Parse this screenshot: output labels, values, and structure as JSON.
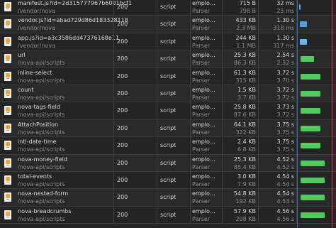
{
  "rows": [
    {
      "name": "manifest.js?id=2d315777967b6001bcf1",
      "path": "/vendor/nova",
      "status": "200",
      "type": "script",
      "init1": "emplo…",
      "init2": "Parser",
      "size1": "715 B",
      "size2": "798 B",
      "time1": "32 ms",
      "time2": "25 ms",
      "bar_start": 0.0,
      "bar_len": 0.03,
      "bar_color": "blue"
    },
    {
      "name": "vendor.js?id=abad729d86d183328118",
      "path": "/vendor/nova",
      "status": "200",
      "type": "script",
      "init1": "emplo…",
      "init2": "Parser",
      "size1": "433 KB",
      "size2": "2.3 MB",
      "time1": "1.30 s",
      "time2": "318 ms",
      "bar_start": 0.02,
      "bar_len": 0.18,
      "bar_color": "blue"
    },
    {
      "name": "app.js?id=a3c3586dd47376168e11",
      "path": "/vendor/nova",
      "status": "200",
      "type": "script",
      "init1": "emplo…",
      "init2": "Parser",
      "size1": "244 KB",
      "size2": "1.1 MB",
      "time1": "1.30 s",
      "time2": "317 ms",
      "bar_start": 0.02,
      "bar_len": 0.18,
      "bar_color": "lblue"
    },
    {
      "name": "url",
      "path": "/nova-api/scripts",
      "status": "200",
      "type": "script",
      "init1": "emplo…",
      "init2": "Parser",
      "size1": "25.3 KB",
      "size2": "86.3 KB",
      "time1": "2.54 s",
      "time2": "2.52 s",
      "bar_start": 0.04,
      "bar_len": 0.34,
      "bar_color": "green"
    },
    {
      "name": "inline-select",
      "path": "/nova-api/scripts",
      "status": "200",
      "type": "script",
      "init1": "emplo…",
      "init2": "Parser",
      "size1": "61.3 KB",
      "size2": "315 KB",
      "time1": "3.72 s",
      "time2": "3.70 s",
      "bar_start": 0.04,
      "bar_len": 0.5,
      "bar_color": "green"
    },
    {
      "name": "count",
      "path": "/nova-api/scripts",
      "status": "200",
      "type": "script",
      "init1": "emplo…",
      "init2": "Parser",
      "size1": "1.5 KB",
      "size2": "3.7 KB",
      "time1": "3.72 s",
      "time2": "3.72 s",
      "bar_start": 0.04,
      "bar_len": 0.5,
      "bar_color": "green"
    },
    {
      "name": "nova-tags-field",
      "path": "/nova-api/scripts",
      "status": "200",
      "type": "script",
      "init1": "emplo…",
      "init2": "Parser",
      "size1": "25.8 KB",
      "size2": "87.6 KB",
      "time1": "3.73 s",
      "time2": "3.72 s",
      "bar_start": 0.04,
      "bar_len": 0.5,
      "bar_color": "green"
    },
    {
      "name": "AttachPosition",
      "path": "/nova-api/scripts",
      "status": "200",
      "type": "script",
      "init1": "emplo…",
      "init2": "Parser",
      "size1": "64.1 KB",
      "size2": "322 KB",
      "time1": "3.75 s",
      "time2": "3.75 s",
      "bar_start": 0.04,
      "bar_len": 0.5,
      "bar_color": "green"
    },
    {
      "name": "intl-date-time",
      "path": "/nova-api/scripts",
      "status": "200",
      "type": "script",
      "init1": "emplo…",
      "init2": "Parser",
      "size1": "2.4 KB",
      "size2": "6.8 KB",
      "time1": "3.75 s",
      "time2": "3.75 s",
      "bar_start": 0.04,
      "bar_len": 0.5,
      "bar_color": "green"
    },
    {
      "name": "nova-money-field",
      "path": "/nova-api/scripts",
      "status": "200",
      "type": "script",
      "init1": "emplo…",
      "init2": "Parser",
      "size1": "25.3 KB",
      "size2": "85.4 KB",
      "time1": "4.52 s",
      "time2": "4.52 s",
      "bar_start": 0.04,
      "bar_len": 0.61,
      "bar_color": "green"
    },
    {
      "name": "total-events",
      "path": "/nova-api/scripts",
      "status": "200",
      "type": "script",
      "init1": "emplo…",
      "init2": "Parser",
      "size1": "3.0 KB",
      "size2": "7.9 KB",
      "time1": "4.54 s",
      "time2": "4.54 s",
      "bar_start": 0.04,
      "bar_len": 0.61,
      "bar_color": "green"
    },
    {
      "name": "nova-nested-form",
      "path": "/nova-api/scripts",
      "status": "200",
      "type": "script",
      "init1": "emplo…",
      "init2": "Parser",
      "size1": "54.8 KB",
      "size2": "192 KB",
      "time1": "4.54 s",
      "time2": "4.53 s",
      "bar_start": 0.04,
      "bar_len": 0.61,
      "bar_color": "green"
    },
    {
      "name": "nova-breadcrumbs",
      "path": "/nova-api/scripts",
      "status": "200",
      "type": "script",
      "init1": "emplo…",
      "init2": "Parser",
      "size1": "57.9 KB",
      "size2": "208 KB",
      "time1": "4.56 s",
      "time2": "4.56 s",
      "bar_start": 0.04,
      "bar_len": 0.61,
      "bar_color": "green"
    }
  ]
}
